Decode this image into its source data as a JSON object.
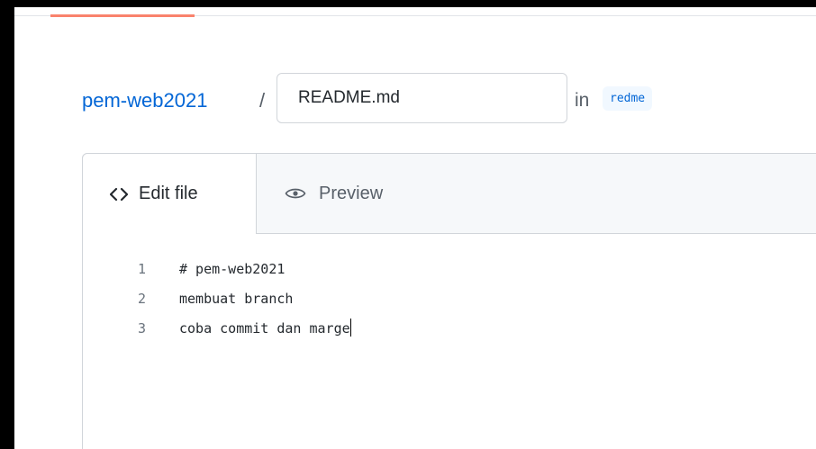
{
  "breadcrumb": {
    "repo": "pem-web2021",
    "separator": "/",
    "filename_value": "README.md",
    "in_label": "in",
    "branch": "redme"
  },
  "tabs": {
    "edit_label": "Edit file",
    "preview_label": "Preview"
  },
  "editor": {
    "lines": [
      {
        "number": "1",
        "text": "# pem-web2021"
      },
      {
        "number": "2",
        "text": "membuat branch"
      },
      {
        "number": "3",
        "text": "coba commit dan marge"
      }
    ]
  },
  "colors": {
    "link": "#0366d6",
    "active_tab_underline": "#f9826c",
    "border": "#d1d5da"
  },
  "icons": {
    "edit_tab": "code-icon",
    "preview_tab": "eye-icon"
  }
}
